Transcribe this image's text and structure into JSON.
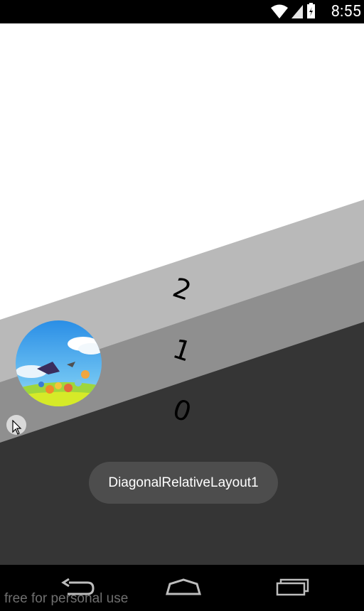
{
  "status_bar": {
    "time": "8:55"
  },
  "layers": [
    {
      "label": "2",
      "color": "#b9b9b9"
    },
    {
      "label": "1",
      "color": "#8f8f8f"
    },
    {
      "label": "0",
      "color": "#353535"
    }
  ],
  "toast": {
    "text": "DiagonalRelativeLayout1"
  },
  "navigation": {
    "back_icon": "back-icon",
    "home_icon": "home-icon",
    "recents_icon": "recents-icon"
  },
  "watermark": {
    "text": "free for personal use"
  }
}
